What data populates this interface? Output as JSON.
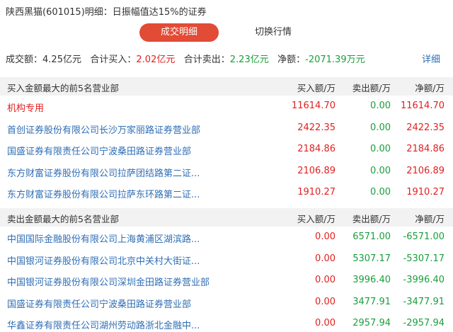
{
  "title": "陕西黑猫(601015)明细：日振幅值达15%的证券",
  "tabs": {
    "active": "成交明细",
    "other": "切换行情"
  },
  "summary": {
    "volume_label": "成交额：",
    "volume_value": "4.25亿元",
    "buy_label": "合计买入：",
    "buy_value": "2.02亿元",
    "sell_label": "合计卖出：",
    "sell_value": "2.23亿元",
    "net_label": "净额：",
    "net_value": "-2071.39万元",
    "details_link": "详细"
  },
  "buy_section": {
    "header": "买入金额最大的前5名营业部",
    "col_buy": "买入额/万",
    "col_sell": "卖出额/万",
    "col_net": "净额/万",
    "rows": [
      {
        "name": "机构专用",
        "buy": "11614.70",
        "sell": "0.00",
        "net": "11614.70"
      },
      {
        "name": "首创证券股份有限公司长沙万家丽路证券营业部",
        "buy": "2422.35",
        "sell": "0.00",
        "net": "2422.35"
      },
      {
        "name": "国盛证券有限责任公司宁波桑田路证券营业部",
        "buy": "2184.86",
        "sell": "0.00",
        "net": "2184.86"
      },
      {
        "name": "东方财富证券股份有限公司拉萨团结路第二证...",
        "buy": "2106.89",
        "sell": "0.00",
        "net": "2106.89"
      },
      {
        "name": "东方财富证券股份有限公司拉萨东环路第二证...",
        "buy": "1910.27",
        "sell": "0.00",
        "net": "1910.27"
      }
    ]
  },
  "sell_section": {
    "header": "卖出金额最大的前5名营业部",
    "col_buy": "买入额/万",
    "col_sell": "卖出额/万",
    "col_net": "净额/万",
    "rows": [
      {
        "name": "中国国际金融股份有限公司上海黄浦区湖滨路...",
        "buy": "0.00",
        "sell": "6571.00",
        "net": "-6571.00"
      },
      {
        "name": "中国银河证券股份有限公司北京中关村大街证...",
        "buy": "0.00",
        "sell": "5307.17",
        "net": "-5307.17"
      },
      {
        "name": "中国银河证券股份有限公司深圳金田路证券营业部",
        "buy": "0.00",
        "sell": "3996.40",
        "net": "-3996.40"
      },
      {
        "name": "国盛证券有限责任公司宁波桑田路证券营业部",
        "buy": "0.00",
        "sell": "3477.91",
        "net": "-3477.91"
      },
      {
        "name": "华鑫证券有限责任公司湖州劳动路浙北金融中...",
        "buy": "0.00",
        "sell": "2957.94",
        "net": "-2957.94"
      }
    ]
  }
}
